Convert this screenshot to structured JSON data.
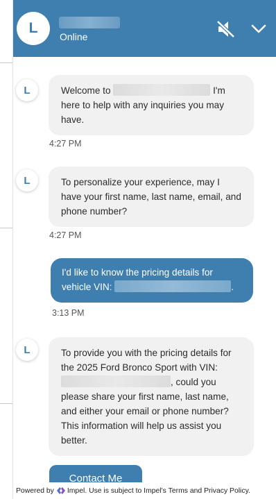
{
  "header": {
    "avatar_letter": "L",
    "status": "Online",
    "mute_icon": "speaker-muted-icon",
    "collapse_icon": "chevron-down-icon"
  },
  "messages": [
    {
      "sender": "agent",
      "avatar_letter": "L",
      "text_before_redaction": "Welcome to",
      "text_after_redaction": "I'm here to help with any inquiries you may have.",
      "time": "4:27 PM"
    },
    {
      "sender": "agent",
      "avatar_letter": "L",
      "text": "To personalize your experience, may I have your first name, last name, email, and phone number?",
      "time": "4:27 PM"
    },
    {
      "sender": "user",
      "text_before_redaction": "I'd like to know the pricing details for vehicle VIN:",
      "text_after_redaction": ".",
      "time": "3:13 PM"
    },
    {
      "sender": "agent",
      "avatar_letter": "L",
      "text_before_redaction": "To provide you with the pricing details for the 2025 Ford Bronco Sport with VIN:",
      "text_after_redaction": ", could you please share your first name, last name, and either your email or phone number? This information will help us assist you better."
    }
  ],
  "contact_button": "Contact Me",
  "footer": {
    "powered_by": "Powered by",
    "brand": "Impel.",
    "use_text": "Use is subject to Impel's",
    "terms": "Terms",
    "and": "and",
    "privacy": "Privacy Policy."
  },
  "colors": {
    "brand_blue": "#3e7fb0",
    "agent_bubble": "#f1f1f1",
    "user_bubble": "#3e7fb0"
  }
}
